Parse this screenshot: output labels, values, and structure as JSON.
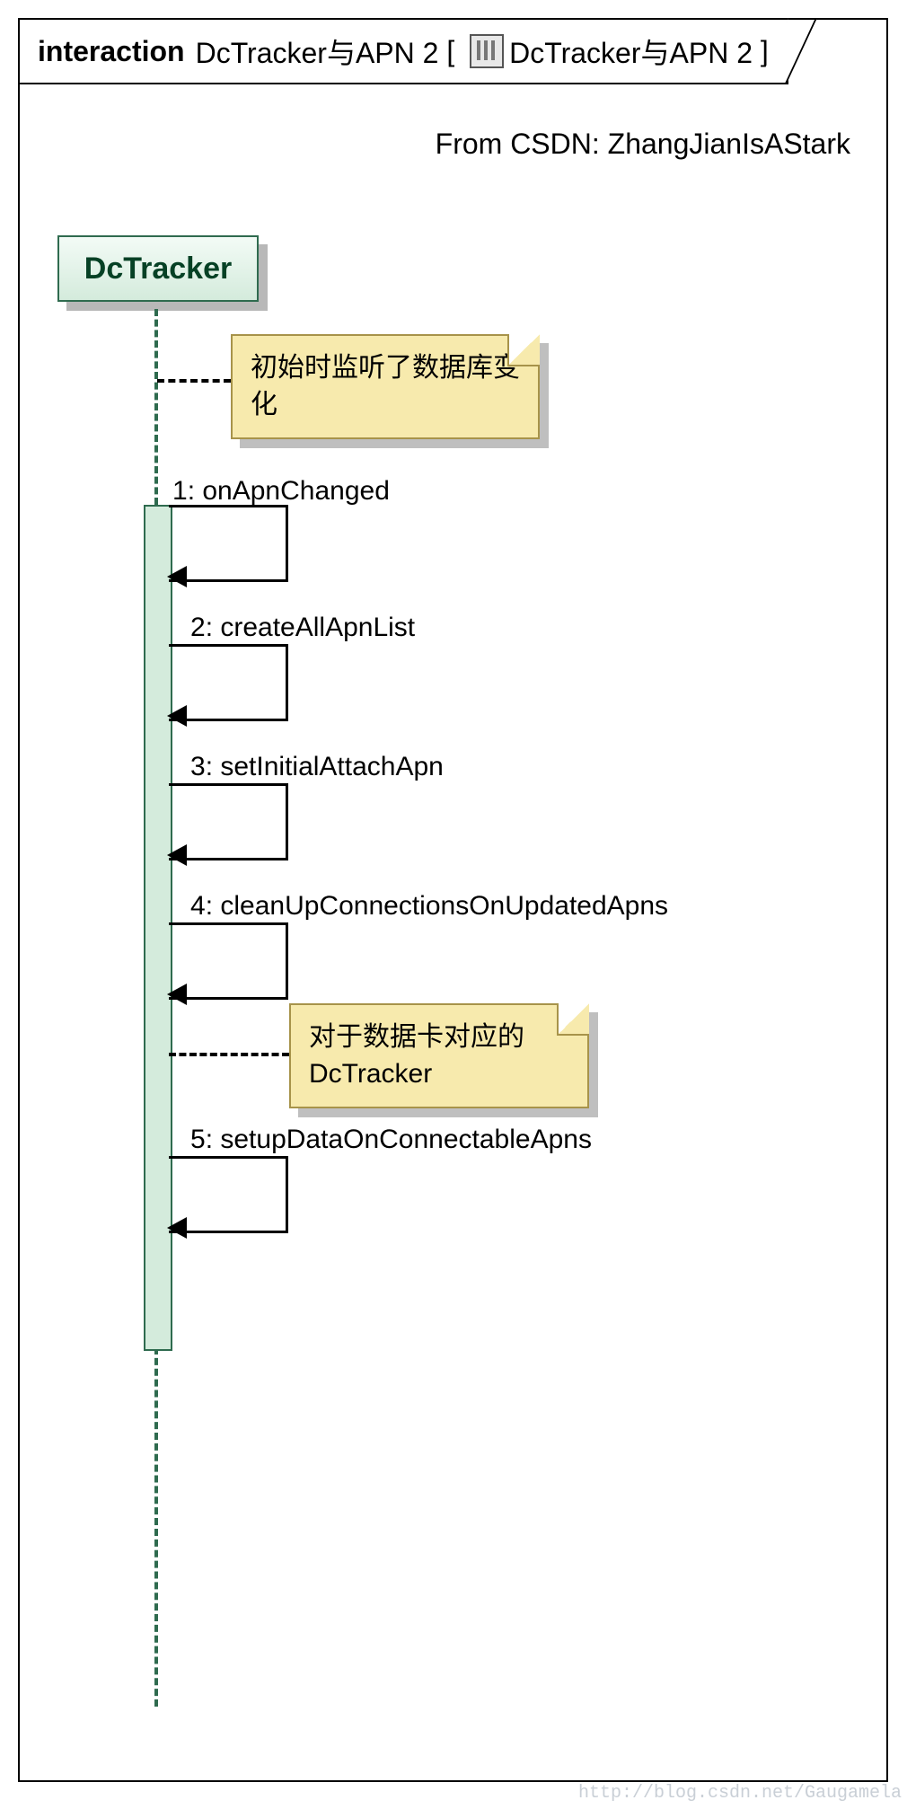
{
  "header": {
    "keyword": "interaction",
    "title": "DcTracker与APN 2",
    "bracket_label": "DcTracker与APN 2"
  },
  "credit": "From CSDN: ZhangJianIsAStark",
  "lifeline": {
    "name": "DcTracker"
  },
  "notes": {
    "note1": "初始时监听了数据库变化",
    "note2_line1": "对于数据卡对应的",
    "note2_line2": "DcTracker"
  },
  "messages": [
    {
      "idx": "1",
      "label": "onApnChanged"
    },
    {
      "idx": "2",
      "label": "createAllApnList"
    },
    {
      "idx": "3",
      "label": "setInitialAttachApn"
    },
    {
      "idx": "4",
      "label": "cleanUpConnectionsOnUpdatedApns"
    },
    {
      "idx": "5",
      "label": "setupDataOnConnectableApns"
    }
  ],
  "watermark": "http://blog.csdn.net/Gaugamela"
}
